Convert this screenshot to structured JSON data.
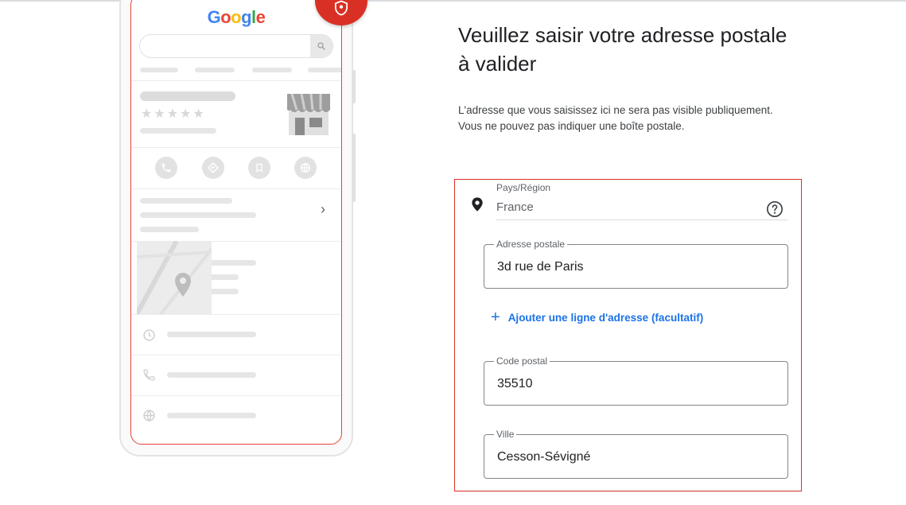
{
  "phone": {
    "logo": {
      "G": "G",
      "o1": "o",
      "o2": "o",
      "g": "g",
      "l": "l",
      "e": "e"
    },
    "colors": {
      "outline": "#ea4335",
      "badge": "#d93025"
    }
  },
  "main": {
    "title": "Veuillez saisir votre adresse postale à valider",
    "description_line1": "L'adresse que vous saisissez ici ne sera pas visible publiquement.",
    "description_line2": "Vous ne pouvez pas indiquer une boîte postale."
  },
  "form": {
    "country": {
      "label": "Pays/Région",
      "value": "France"
    },
    "street": {
      "label": "Adresse postale",
      "value": "3d rue de Paris"
    },
    "add_line": {
      "label": "Ajouter une ligne d'adresse (facultatif)"
    },
    "postal_code": {
      "label": "Code postal",
      "value": "35510"
    },
    "city": {
      "label": "Ville",
      "value": "Cesson-Sévigné"
    }
  },
  "colors": {
    "accent": "#1a73e8",
    "highlight_border": "#d93025",
    "text": "#202124"
  }
}
